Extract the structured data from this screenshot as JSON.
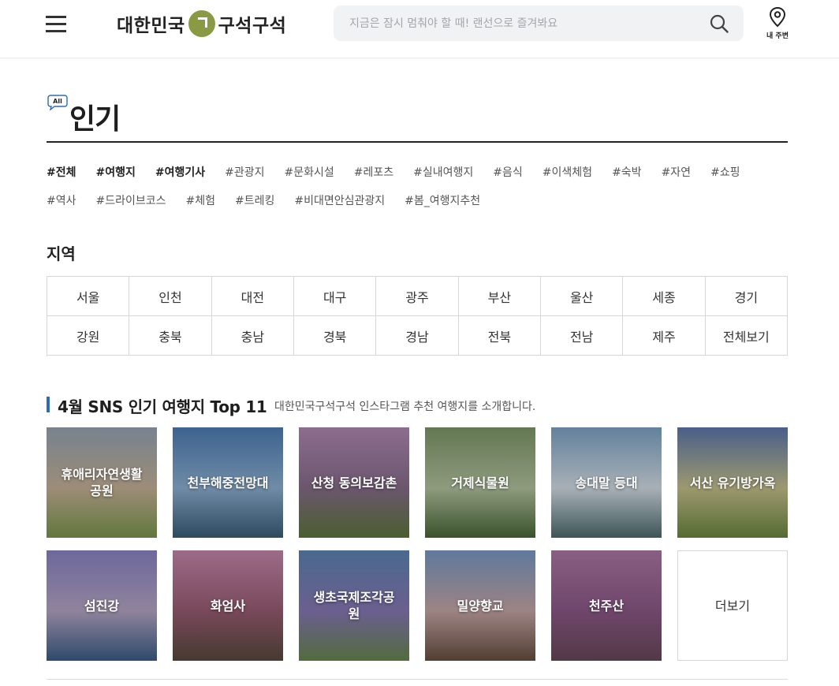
{
  "header": {
    "logo_left": "대한민국",
    "logo_right": "구석구석",
    "search_placeholder": "지금은 잠시 멈춰야 할 때! 랜선으로 즐겨봐요",
    "nearby_label": "내 주변"
  },
  "popular": {
    "badge": "All",
    "title": "인기",
    "tags_row1": [
      {
        "label": "#전체",
        "bold": true
      },
      {
        "label": "#여행지",
        "bold": true
      },
      {
        "label": "#여행기사",
        "bold": true
      },
      {
        "label": "#관광지",
        "bold": false
      },
      {
        "label": "#문화시설",
        "bold": false
      },
      {
        "label": "#레포츠",
        "bold": false
      },
      {
        "label": "#실내여행지",
        "bold": false
      },
      {
        "label": "#음식",
        "bold": false
      },
      {
        "label": "#이색체험",
        "bold": false
      },
      {
        "label": "#숙박",
        "bold": false
      },
      {
        "label": "#자연",
        "bold": false
      },
      {
        "label": "#쇼핑",
        "bold": false
      }
    ],
    "tags_row2": [
      {
        "label": "#역사",
        "bold": false
      },
      {
        "label": "#드라이브코스",
        "bold": false
      },
      {
        "label": "#체험",
        "bold": false
      },
      {
        "label": "#트레킹",
        "bold": false
      },
      {
        "label": "#비대면안심관광지",
        "bold": false
      },
      {
        "label": "#봄_여행지추천",
        "bold": false
      }
    ]
  },
  "region": {
    "title": "지역",
    "cells": [
      "서울",
      "인천",
      "대전",
      "대구",
      "광주",
      "부산",
      "울산",
      "세종",
      "경기",
      "강원",
      "충북",
      "충남",
      "경북",
      "경남",
      "전북",
      "전남",
      "제주",
      "전체보기"
    ]
  },
  "top11": {
    "title": "4월 SNS 인기 여행지 Top 11",
    "subtitle": "대한민국구석구석 인스타그램 추천 여행지를 소개합니다.",
    "items": [
      {
        "label": "휴애리자연생활\n공원",
        "palette": [
          "#9aa7b8",
          "#c9b59a",
          "#7e9a4e"
        ]
      },
      {
        "label": "천부해중전망대",
        "palette": [
          "#4f7fb7",
          "#8fb3d6",
          "#3a5f7a"
        ]
      },
      {
        "label": "산청 동의보감촌",
        "palette": [
          "#b48bb8",
          "#8a6f8d",
          "#5f7a3c"
        ]
      },
      {
        "label": "거제식물원",
        "palette": [
          "#7f9a6a",
          "#b7c7a2",
          "#4a6a38"
        ]
      },
      {
        "label": "송대말 등대",
        "palette": [
          "#7fa6c9",
          "#d8e2ea",
          "#4f6d6e"
        ]
      },
      {
        "label": "서산 유기방가옥",
        "palette": [
          "#5f7ab0",
          "#c9c48f",
          "#6d8a3f"
        ]
      },
      {
        "label": "섬진강",
        "palette": [
          "#8d86c8",
          "#b9a9c8",
          "#3b5f8a"
        ]
      },
      {
        "label": "화엄사",
        "palette": [
          "#c98ab0",
          "#9b5e74",
          "#5a4a3f"
        ]
      },
      {
        "label": "생초국제조각공\n원",
        "palette": [
          "#5f87b8",
          "#8a7ab8",
          "#6a8a4f"
        ]
      },
      {
        "label": "밀양향교",
        "palette": [
          "#7b9cc9",
          "#c9a9a9",
          "#6a5040"
        ]
      },
      {
        "label": "천주산",
        "palette": [
          "#b07aa8",
          "#8f5a8a",
          "#6a4a5a"
        ]
      }
    ],
    "more_label": "더보기"
  }
}
